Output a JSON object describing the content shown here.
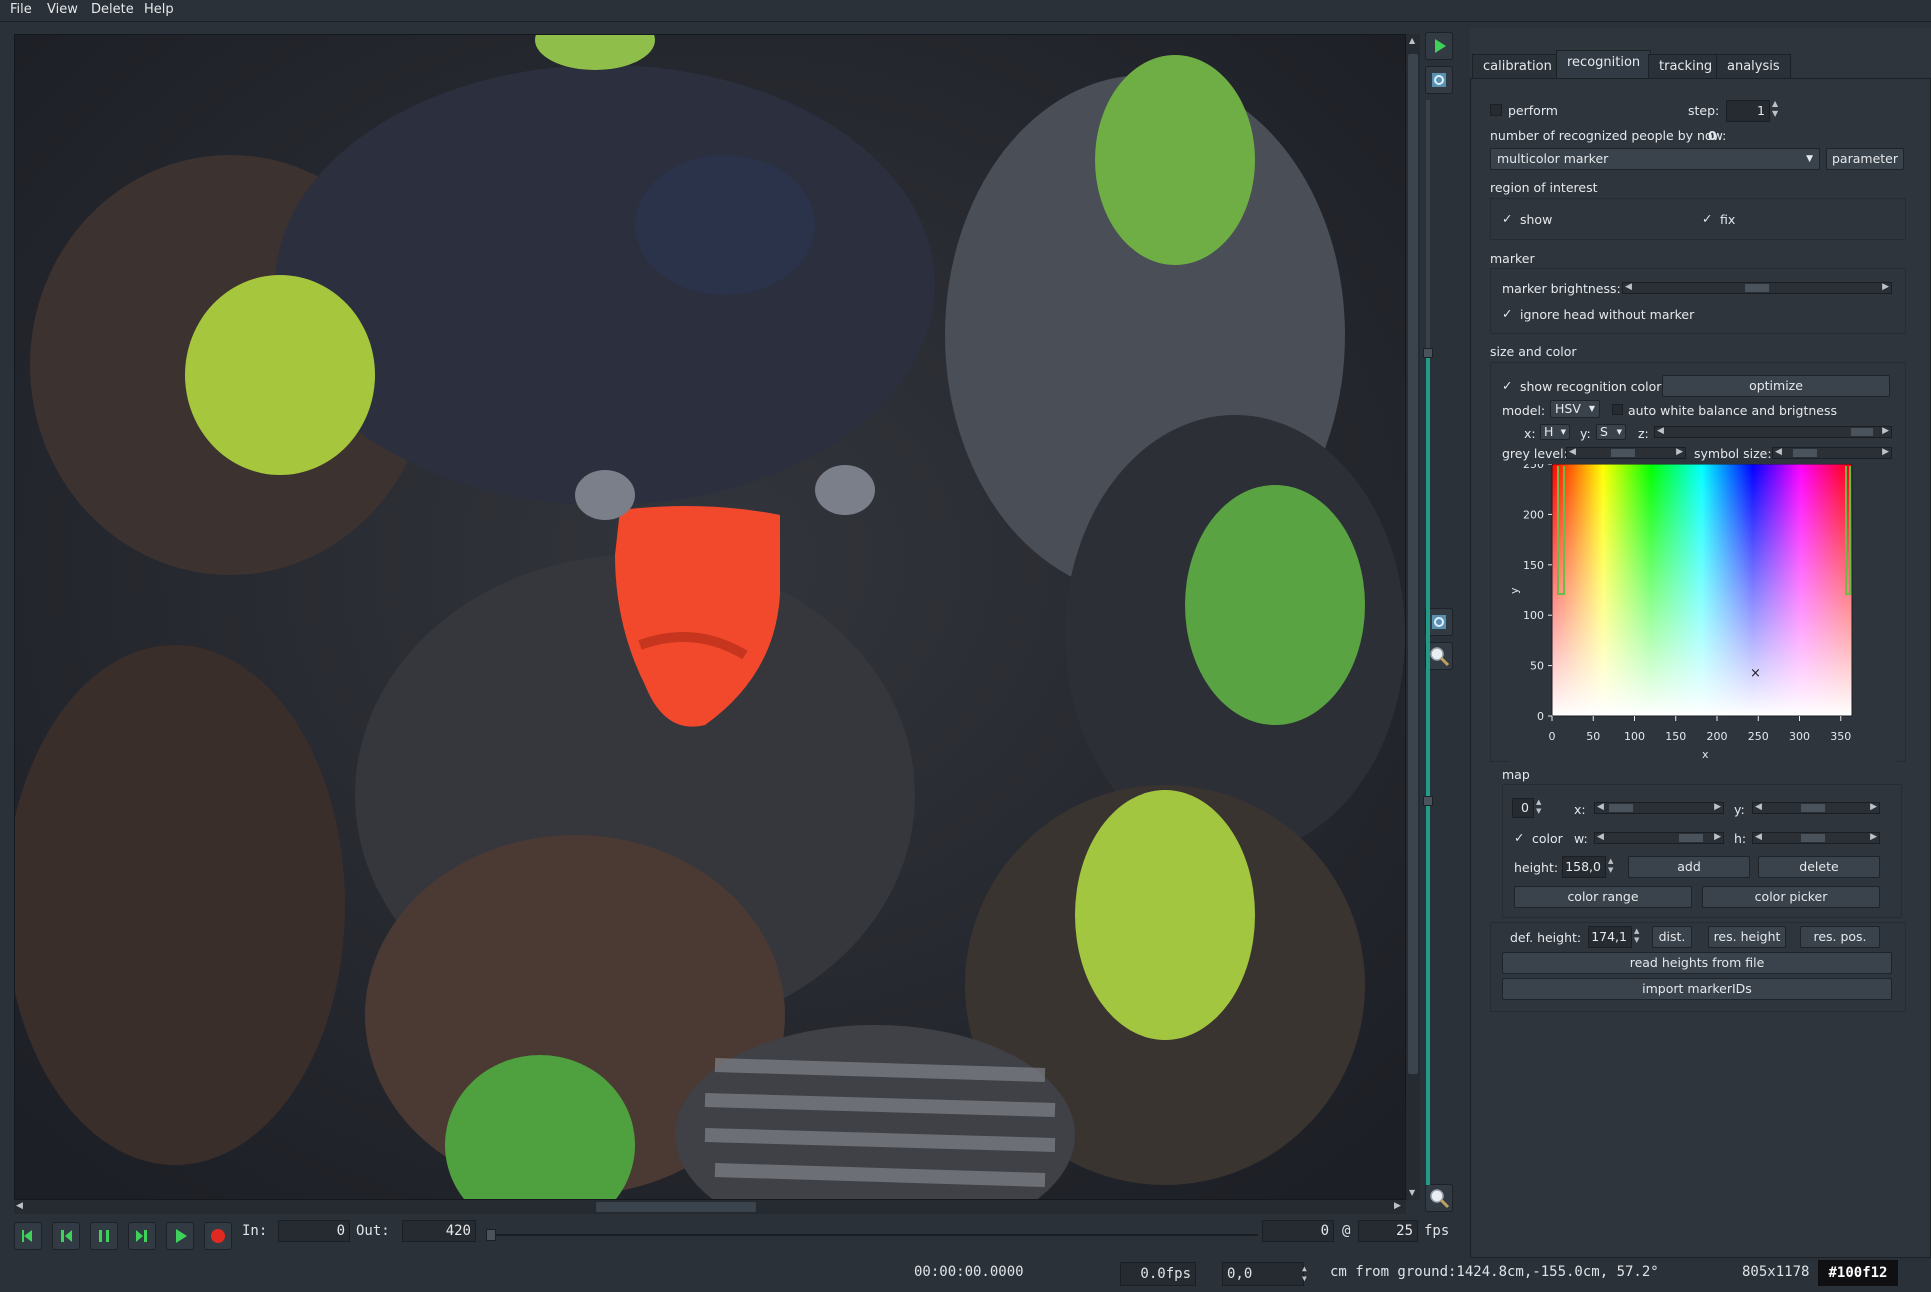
{
  "menu": [
    "File",
    "View",
    "Delete",
    "Help"
  ],
  "tabs": [
    "calibration",
    "recognition",
    "tracking",
    "analysis"
  ],
  "recognition": {
    "perform_label": "perform",
    "step_label": "step:",
    "step_value": "1",
    "count_label": "number of recognized people by now:",
    "count_value": "0",
    "method_select": "multicolor marker",
    "parameter_button": "parameter",
    "roi_header": "region of interest",
    "show_label": "show",
    "fix_label": "fix",
    "marker_header": "marker",
    "marker_brightness_label": "marker brightness:",
    "ignore_head_label": "ignore head without marker",
    "size_color_header": "size and color",
    "show_recog_color_label": "show recognition color",
    "optimize_button": "optimize",
    "model_label": "model:",
    "model_value": "HSV",
    "auto_wb_label": "auto white balance and brigtness",
    "x_label": "x:",
    "x_value": "H",
    "y_label": "y:",
    "y_value": "S",
    "z_label": "z:",
    "grey_level_label": "grey level:",
    "symbol_size_label": "symbol size:",
    "map_header": "map",
    "map_index": "0",
    "map_x_label": "x:",
    "map_y_label": "y:",
    "map_color_label": "color",
    "map_w_label": "w:",
    "map_h_label": "h:",
    "height_label": "height:",
    "height_value": "158,0",
    "add_button": "add",
    "delete_button": "delete",
    "color_range_button": "color range",
    "color_picker_button": "color picker",
    "def_height_label": "def. height:",
    "def_height_value": "174,1",
    "dist_button": "dist.",
    "res_height_button": "res. height",
    "res_pos_button": "res. pos.",
    "read_heights_button": "read heights from file",
    "import_markers_button": "import markerIDs"
  },
  "color_plot": {
    "xlabel": "x",
    "ylabel": "y",
    "x_ticks": [
      "0",
      "50",
      "100",
      "150",
      "200",
      "250",
      "300",
      "350"
    ],
    "y_ticks": [
      "250",
      "200",
      "150",
      "100",
      "50",
      "0"
    ],
    "marker_symbol": "×"
  },
  "player": {
    "in_label": "In:",
    "in_value": "0",
    "out_label": "Out:",
    "out_value": "420",
    "frame_value": "0",
    "at_label": "@",
    "fps_value": "25",
    "fps_label": "fps"
  },
  "status": {
    "time": "00:00:00.0000",
    "fps": "0.0fps",
    "coord": "0,0",
    "ground": "cm from ground:1424.8cm,-155.0cm, 57.2°",
    "size": "805x1178",
    "color": "#100f12"
  },
  "icons": [
    "play-icon",
    "refresh-icon",
    "zoom-icon",
    "record-icon",
    "skip-back-icon",
    "step-back-icon",
    "pause-icon",
    "step-forward-icon"
  ]
}
